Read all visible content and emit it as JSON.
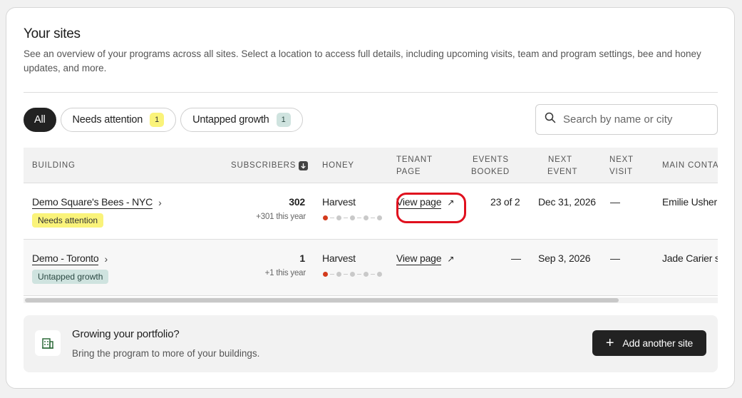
{
  "header": {
    "title": "Your sites",
    "description": "See an overview of your programs across all sites. Select a location to access full details, including upcoming visits, team and program settings, bee and honey updates, and more."
  },
  "filters": [
    {
      "label": "All",
      "active": true
    },
    {
      "label": "Needs attention",
      "count": "1"
    },
    {
      "label": "Untapped growth",
      "count": "1"
    }
  ],
  "search": {
    "placeholder": "Search by name or city"
  },
  "table": {
    "columns": {
      "building": "Building",
      "subscribers": "Subscribers",
      "honey": "Honey",
      "tenant_page_1": "Tenant",
      "tenant_page_2": "Page",
      "events_1": "Events",
      "events_2": "Booked",
      "next_event_1": "Next",
      "next_event_2": "Event",
      "next_visit_1": "Next",
      "next_visit_2": "Visit",
      "main_contact": "Main Contact"
    },
    "rows": [
      {
        "building": "Demo Square's Bees - NYC",
        "tag": "Needs attention",
        "subscribers": "302",
        "subscribers_delta": "+301 this year",
        "honey": "Harvest",
        "honey_progress_step": 1,
        "honey_progress_total": 5,
        "tenant_page": "View page",
        "events_booked": "23 of 2",
        "next_event": "Dec 31, 2026",
        "next_visit": "—",
        "main_contact": "Emilie Usher"
      },
      {
        "building": "Demo - Toronto",
        "tag": "Untapped growth",
        "subscribers": "1",
        "subscribers_delta": "+1 this year",
        "honey": "Harvest",
        "honey_progress_step": 1,
        "honey_progress_total": 5,
        "tenant_page": "View page",
        "events_booked": "—",
        "next_event": "Sep 3, 2026",
        "next_visit": "—",
        "main_contact": "Jade Carier s"
      }
    ]
  },
  "promo": {
    "title": "Growing your portfolio?",
    "text": "Bring the program to more of your buildings.",
    "button": "Add another site"
  },
  "icons": {
    "search": "search-icon",
    "sort": "sort-down-icon",
    "chevron": "chevron-right-icon",
    "external": "external-link-icon",
    "building": "building-icon",
    "plus": "plus-icon"
  },
  "colors": {
    "accent_dark": "#222222",
    "badge_yellow": "#faf37a",
    "badge_teal": "#cfe3df",
    "progress_active": "#d33a1c",
    "highlight": "#e0101e"
  }
}
